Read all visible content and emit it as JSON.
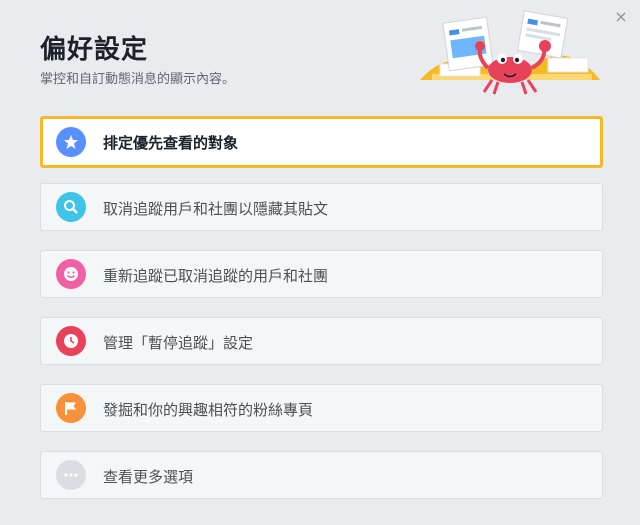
{
  "header": {
    "title": "偏好設定",
    "subtitle": "掌控和自訂動態消息的顯示內容。",
    "close_glyph": "×"
  },
  "items": [
    {
      "label": "排定優先查看的對象",
      "icon": "star-icon",
      "color": "#5890ff",
      "selected": true
    },
    {
      "label": "取消追蹤用戶和社團以隱藏其貼文",
      "icon": "search-icon",
      "color": "#3fc3e8"
    },
    {
      "label": "重新追蹤已取消追蹤的用戶和社團",
      "icon": "smile-icon",
      "color": "#f35fa5"
    },
    {
      "label": "管理「暫停追蹤」設定",
      "icon": "clock-icon",
      "color": "#e8415a"
    },
    {
      "label": "發掘和你的興趣相符的粉絲專頁",
      "icon": "flag-icon",
      "color": "#f7923a"
    },
    {
      "label": "查看更多選項",
      "icon": "more-icon",
      "color": "#dadde1"
    }
  ]
}
